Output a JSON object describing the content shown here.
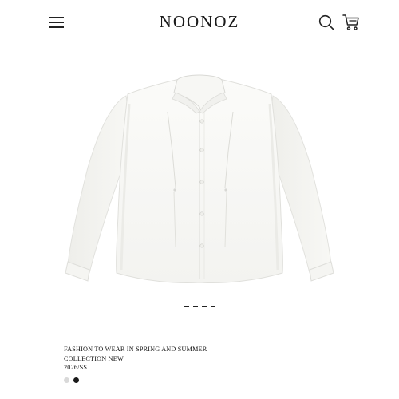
{
  "header": {
    "brand": "NOONOZ",
    "menu_icon": "hamburger-menu-icon",
    "search_icon": "search-icon",
    "cart_icon": "shopping-cart-icon"
  },
  "hero": {
    "image": "white-long-sleeve-shirt",
    "carousel_slides": 4
  },
  "caption": {
    "line1": "FASHION TO WEAR IN SPRING AND SUMMER",
    "line2": "COLLECTION NEW",
    "season": "2026/SS"
  },
  "swatches": {
    "colors": [
      "#d9d9d9",
      "#1a1a1a"
    ]
  }
}
